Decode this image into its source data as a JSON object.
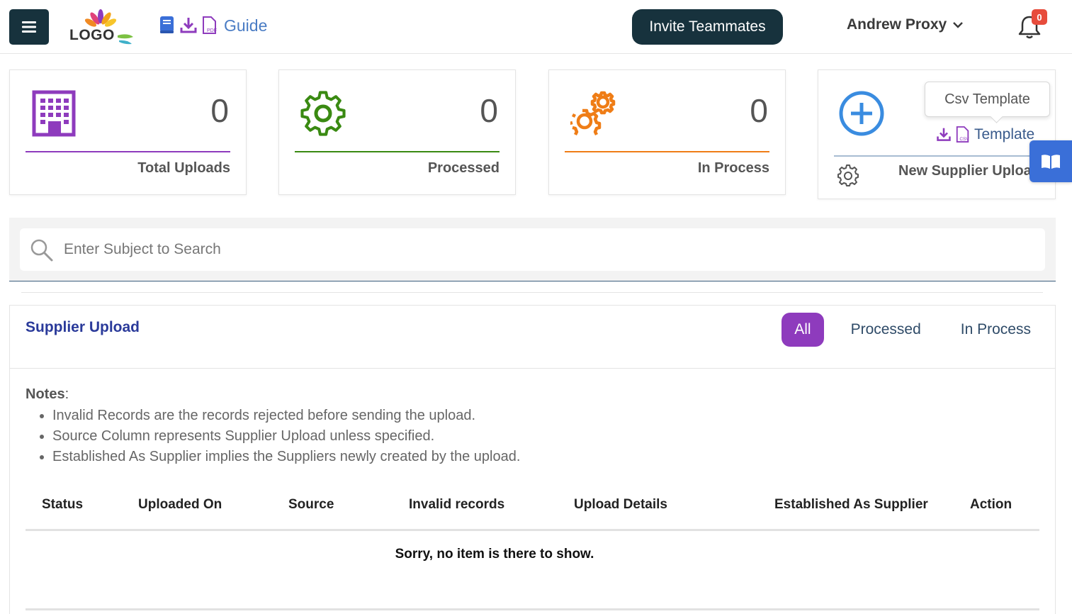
{
  "header": {
    "logo_text": "LOGO",
    "guide_label": "Guide",
    "invite_label": "Invite Teammates",
    "user_name": "Andrew Proxy",
    "notification_count": "0"
  },
  "stats": [
    {
      "count": "0",
      "label": "Total Uploads",
      "color": "#8e3bbd"
    },
    {
      "count": "0",
      "label": "Processed",
      "color": "#3a8a12"
    },
    {
      "count": "0",
      "label": "In Process",
      "color": "#ef7d16"
    }
  ],
  "new_upload": {
    "template_label": "Template",
    "label": "New Supplier Upload",
    "tooltip": "Csv Template"
  },
  "search": {
    "placeholder": "Enter Subject to Search"
  },
  "panel": {
    "title": "Supplier Upload",
    "tabs": [
      "All",
      "Processed",
      "In Process"
    ],
    "active_tab": "All"
  },
  "notes": {
    "title": "Notes",
    "items": [
      "Invalid Records are the records rejected before sending the upload.",
      "Source Column represents Supplier Upload unless specified.",
      "Established As Supplier implies the Suppliers newly created by the upload."
    ]
  },
  "table": {
    "columns": [
      "Status",
      "Uploaded On",
      "Source",
      "Invalid records",
      "Upload Details",
      "Established As Supplier",
      "Action"
    ],
    "empty_message": "Sorry, no item is there to show."
  },
  "colors": {
    "navy": "#17323d",
    "purple": "#8e3bbd",
    "blue": "#3a6fd8",
    "title_blue": "#2a3a9a"
  }
}
